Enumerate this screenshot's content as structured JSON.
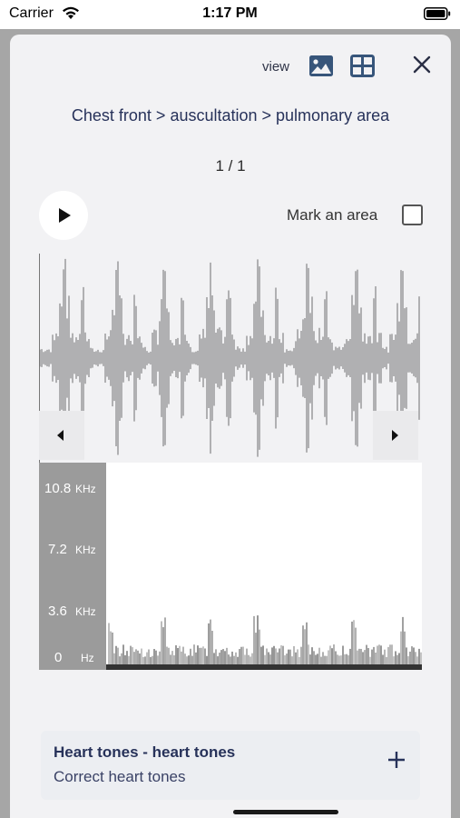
{
  "status_bar": {
    "carrier": "Carrier",
    "time": "1:17 PM"
  },
  "header": {
    "view_label": "view",
    "icons": [
      "image-view-icon",
      "grid-view-icon",
      "close-icon"
    ]
  },
  "breadcrumb": "Chest front > auscultation > pulmonary area",
  "pager": "1 / 1",
  "player": {
    "mark_area_label": "Mark an area",
    "mark_area_checked": false
  },
  "spectrogram": {
    "axis": [
      {
        "value": "10.8",
        "unit": "KHz"
      },
      {
        "value": "7.2",
        "unit": "KHz"
      },
      {
        "value": "3.6",
        "unit": "KHz"
      },
      {
        "value": "0",
        "unit": "Hz"
      }
    ]
  },
  "finding": {
    "title": "Heart tones - heart tones",
    "subtitle": "Correct heart tones"
  },
  "colors": {
    "accent": "#27325a",
    "icon": "#37557a"
  }
}
